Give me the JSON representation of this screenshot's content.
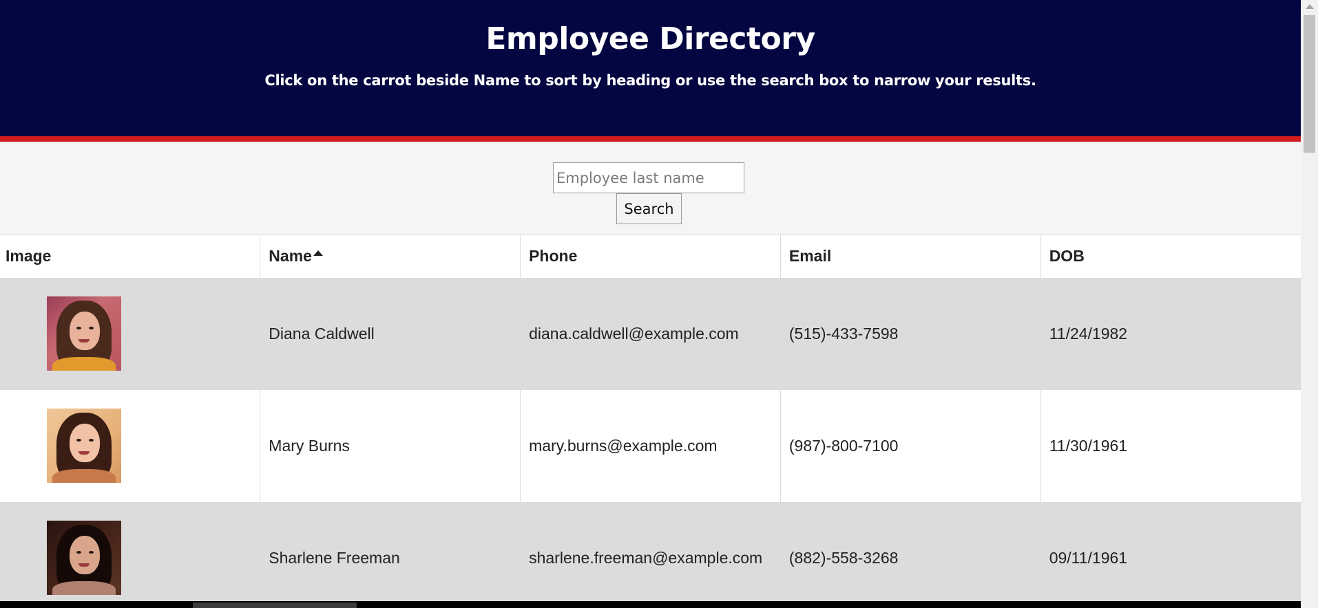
{
  "header": {
    "title": "Employee Directory",
    "subtitle": "Click on the carrot beside Name to sort by heading or use the search box to narrow your results."
  },
  "search": {
    "placeholder": "Employee last name",
    "value": "",
    "button_label": "Search"
  },
  "table": {
    "columns": [
      "Image",
      "Name",
      "Phone",
      "Email",
      "DOB"
    ],
    "sort": {
      "column": "Name",
      "direction": "ascending",
      "icon": "caret-up-icon"
    },
    "rows": [
      {
        "image": "employee-photo",
        "name": "Diana Caldwell",
        "phone": "diana.caldwell@example.com",
        "email": "(515)-433-7598",
        "dob": "11/24/1982"
      },
      {
        "image": "employee-photo",
        "name": "Mary Burns",
        "phone": "mary.burns@example.com",
        "email": "(987)-800-7100",
        "dob": "11/30/1961"
      },
      {
        "image": "employee-photo",
        "name": "Sharlene Freeman",
        "phone": "sharlene.freeman@example.com",
        "email": "(882)-558-3268",
        "dob": "09/11/1961"
      }
    ]
  },
  "colors": {
    "header_bg": "#030640",
    "header_border": "#d01b1f",
    "row_alt_bg": "#dcdcdc",
    "page_bg": "#f5f5f5"
  }
}
